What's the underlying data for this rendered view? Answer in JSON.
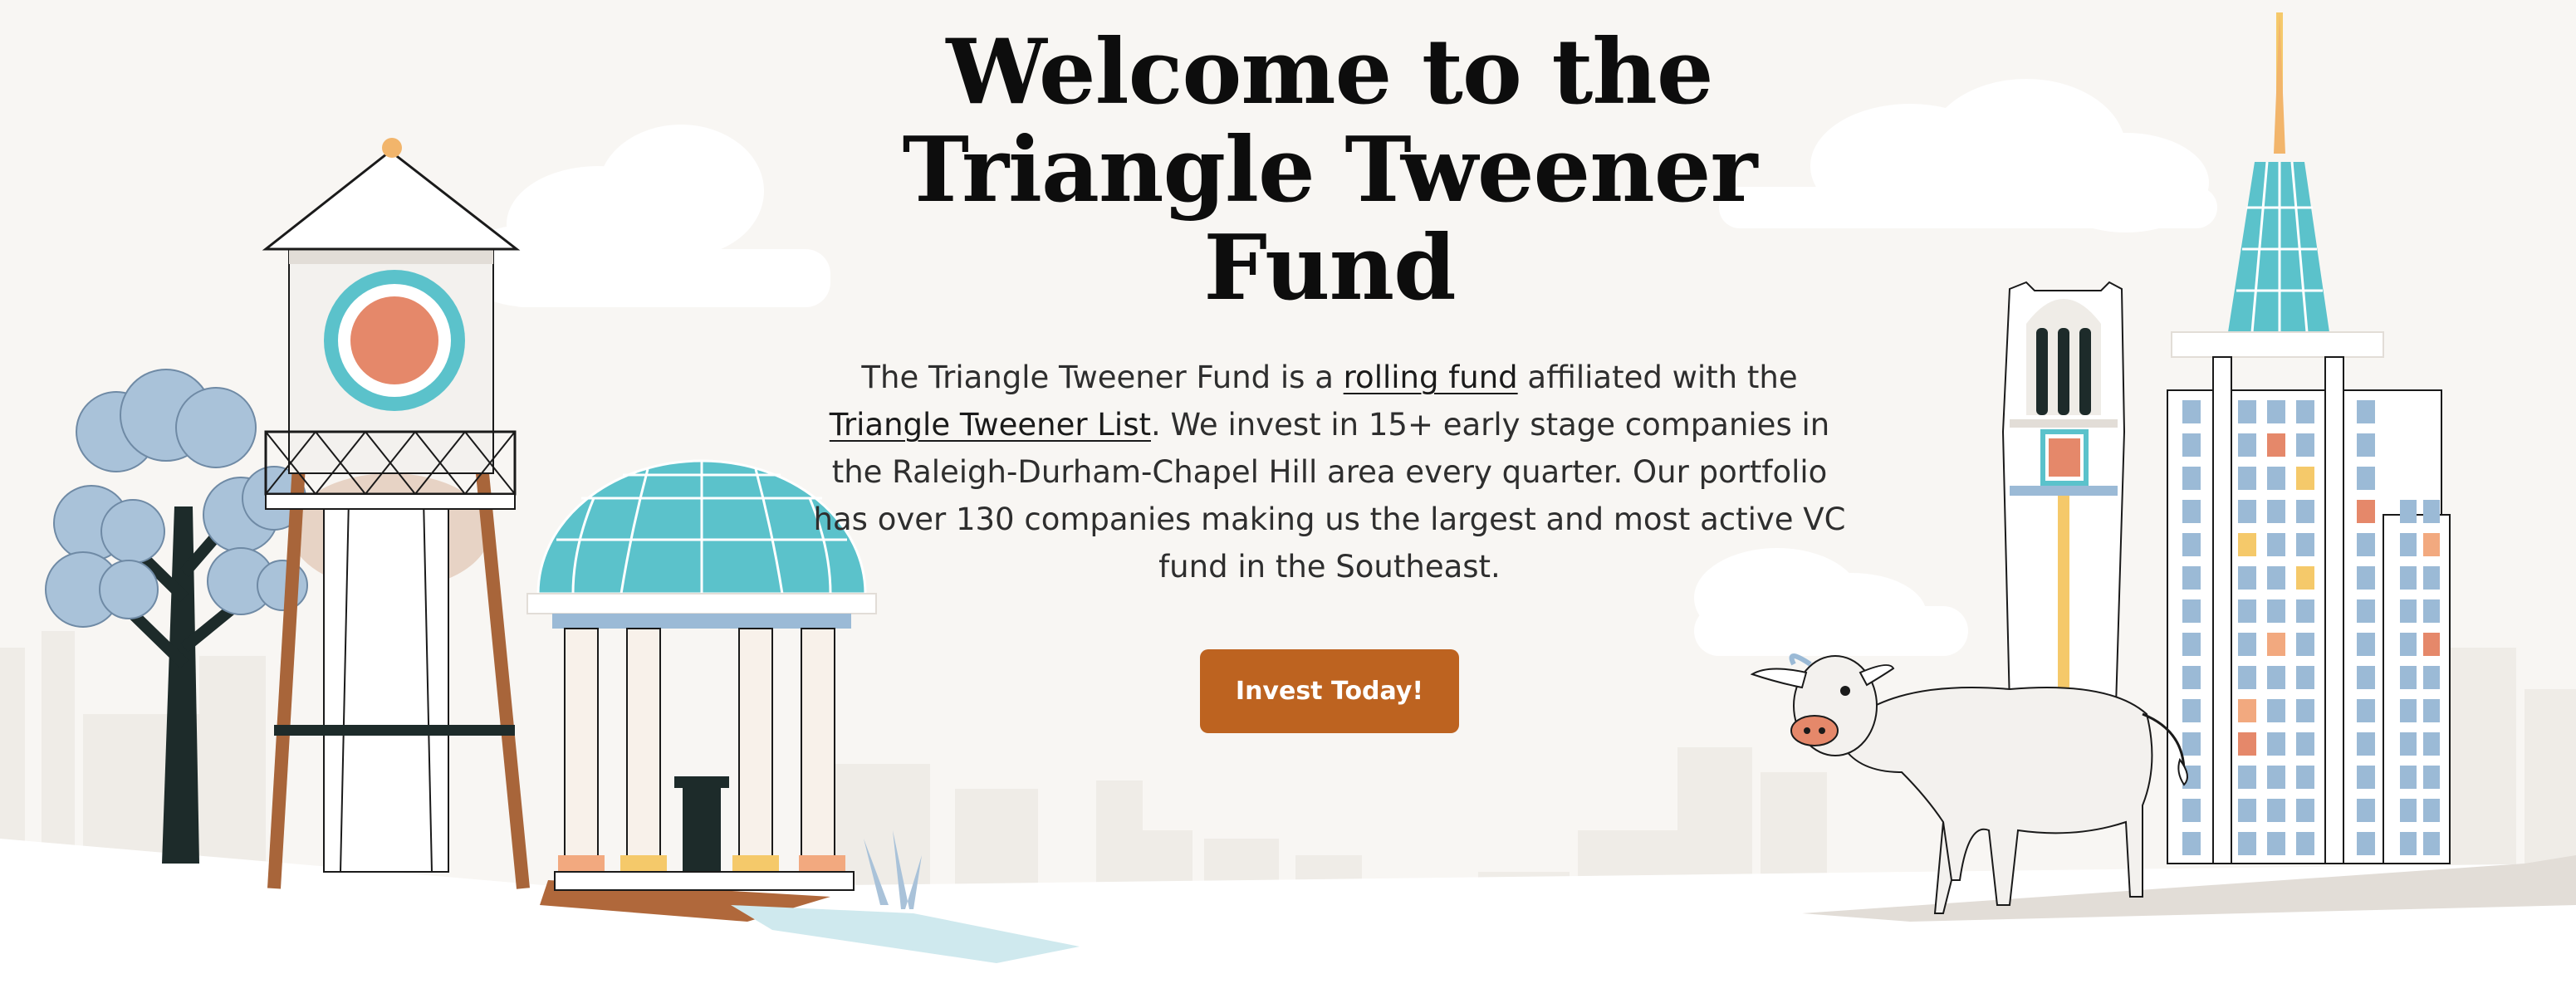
{
  "hero": {
    "title_line1": "Welcome to the",
    "title_line2": "Triangle Tweener Fund",
    "desc_part1": "The Triangle Tweener Fund is a ",
    "rolling_fund_link": "rolling fund",
    "desc_part2": " affiliated with the ",
    "tweener_list_link": "Triangle Tweener List",
    "desc_part3": ". We invest in 15+ early stage companies in the Raleigh-Durham-Chapel Hill area every quarter. Our portfolio has over 130 companies making us the largest and most active VC fund in the Southeast.",
    "cta_label": "Invest Today!"
  },
  "colors": {
    "background": "#f8f6f3",
    "cta": "#bd6320",
    "teal": "#5bc2cb",
    "coral": "#e5886a",
    "window_blue": "#9bbad6",
    "wood": "#a8653a"
  }
}
